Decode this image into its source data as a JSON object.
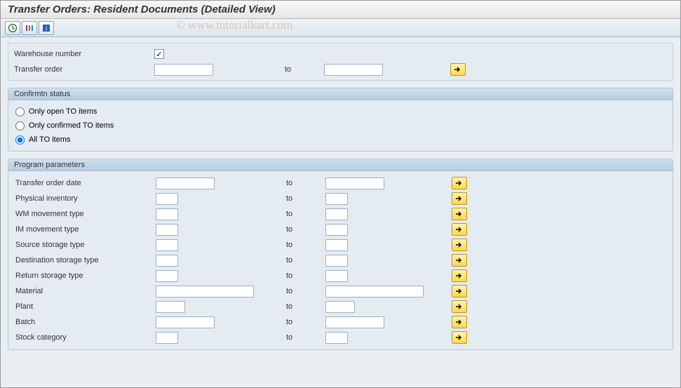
{
  "title": "Transfer Orders: Resident Documents (Detailed View)",
  "watermark": "© www.tutorialkart.com",
  "toolbar": {
    "execute": "execute",
    "variant": "variant",
    "info": "info"
  },
  "top": {
    "warehouse_label": "Warehouse number",
    "warehouse_value": "",
    "warehouse_checked": "✓",
    "transfer_order_label": "Transfer order",
    "transfer_order_from": "",
    "to_label": "to",
    "transfer_order_to": ""
  },
  "confirm": {
    "header": "Confirmtn status",
    "opt_open": "Only open TO items",
    "opt_confirmed": "Only confirmed TO items",
    "opt_all": "All TO items",
    "selected": "all"
  },
  "params": {
    "header": "Program parameters",
    "to_label": "to",
    "rows": [
      {
        "label": "Transfer order date",
        "fw": "84",
        "tw": "84"
      },
      {
        "label": "Physical inventory",
        "fw": "32",
        "tw": "32"
      },
      {
        "label": "WM movement type",
        "fw": "32",
        "tw": "32"
      },
      {
        "label": "IM movement type",
        "fw": "32",
        "tw": "32"
      },
      {
        "label": "Source storage type",
        "fw": "32",
        "tw": "32"
      },
      {
        "label": "Destination storage type",
        "fw": "32",
        "tw": "32"
      },
      {
        "label": "Return storage type",
        "fw": "32",
        "tw": "32"
      },
      {
        "label": "Material",
        "fw": "140",
        "tw": "140"
      },
      {
        "label": "Plant",
        "fw": "42",
        "tw": "42"
      },
      {
        "label": "Batch",
        "fw": "84",
        "tw": "84"
      },
      {
        "label": "Stock category",
        "fw": "32",
        "tw": "32"
      }
    ]
  }
}
